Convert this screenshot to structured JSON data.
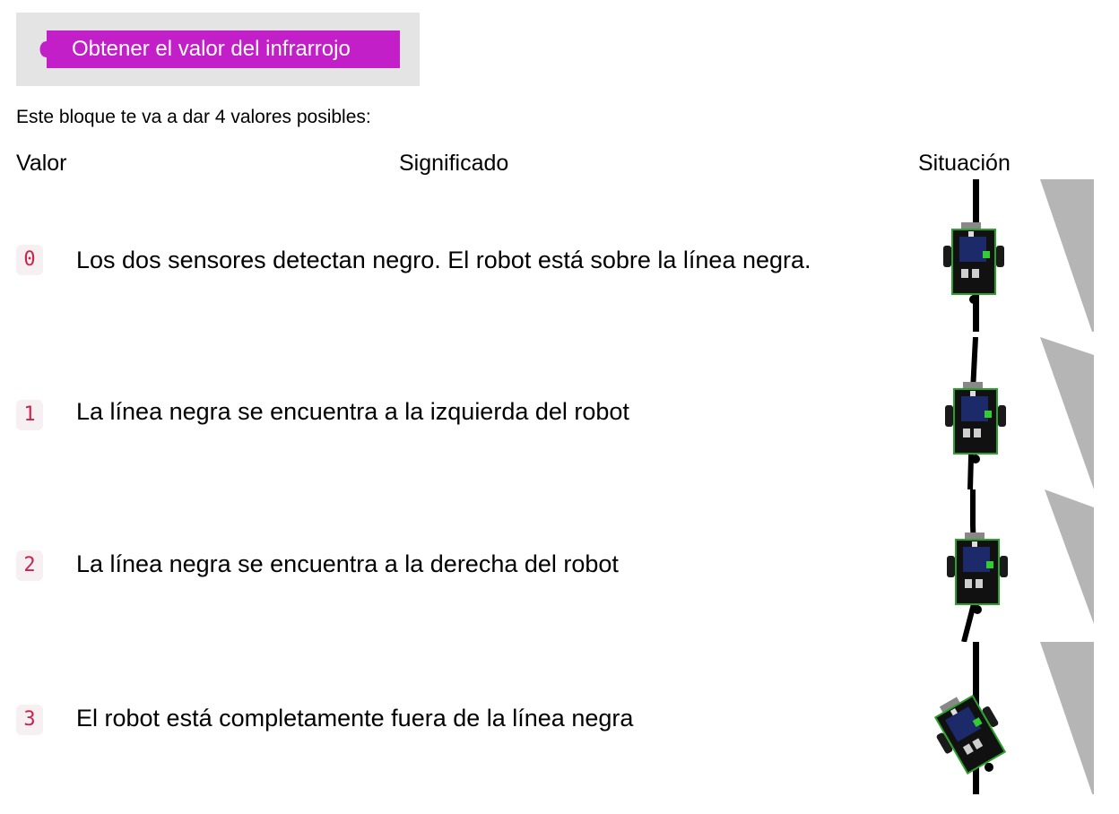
{
  "block": {
    "label": "Obtener el valor del infrarrojo",
    "color": "#c21fc8"
  },
  "intro": "Este bloque te va a dar 4 valores posibles:",
  "table": {
    "headers": {
      "value": "Valor",
      "meaning": "Significado",
      "situation": "Situación"
    },
    "rows": [
      {
        "value": "0",
        "meaning": "Los dos sensores detectan negro. El robot está sobre la línea negra.",
        "situation_icon": "robot-on-line-image"
      },
      {
        "value": "1",
        "meaning": "La línea negra se encuentra a la izquierda del robot",
        "situation_icon": "robot-line-left-image"
      },
      {
        "value": "2",
        "meaning": "La línea negra se encuentra a la derecha del robot",
        "situation_icon": "robot-line-right-image"
      },
      {
        "value": "3",
        "meaning": "El robot está completamente fuera de la línea negra",
        "situation_icon": "robot-off-line-image"
      }
    ]
  }
}
